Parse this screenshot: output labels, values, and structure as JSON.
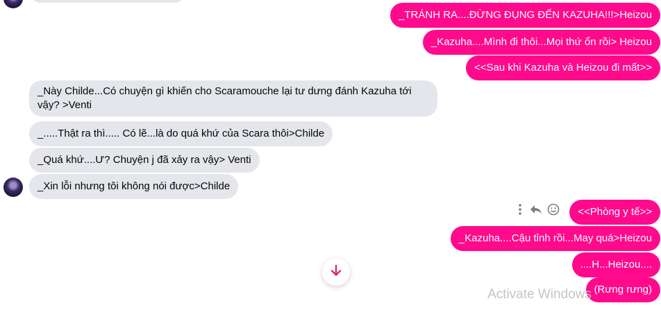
{
  "messages_out_top": [
    "_TRÁNH RA....ĐỪNG ĐỤNG ĐẾN KAZUHA!!!>Heizou",
    "_Kazuha....Mình đi thôi...Mọi thứ ổn rồi> Heizou",
    "<<Sau khi Kazuha và Heizou đi mất>>"
  ],
  "messages_in": [
    "_Này Childe...Có chuyện gì khiến cho Scaramouche lại tư dưng đánh Kazuha tới vậy? >Venti",
    "_.....Thật ra thì..... Có lẽ...là do quá khứ của Scara thôi>Childe",
    "_Quá khứ....Ư? Chuyện j đã xảy ra vậy> Venti",
    "_Xin lỗi nhưng tôi không nói được>Childe"
  ],
  "messages_out_bottom": [
    "<<Phòng y tế>>",
    "_Kazuha....Cậu tỉnh rồi...May quá>Heizou",
    "....H...Heizou....",
    "(Rưng rưng)"
  ],
  "watermark": "Activate Windows",
  "icons": {
    "more": "more-vertical-icon",
    "reply": "reply-icon",
    "react": "smiley-icon",
    "scroll": "arrow-down-icon"
  },
  "colors": {
    "outgoing_bubble": "#ff0a8c",
    "incoming_bubble": "#e4e6eb",
    "scroll_arrow": "#e0217e"
  }
}
